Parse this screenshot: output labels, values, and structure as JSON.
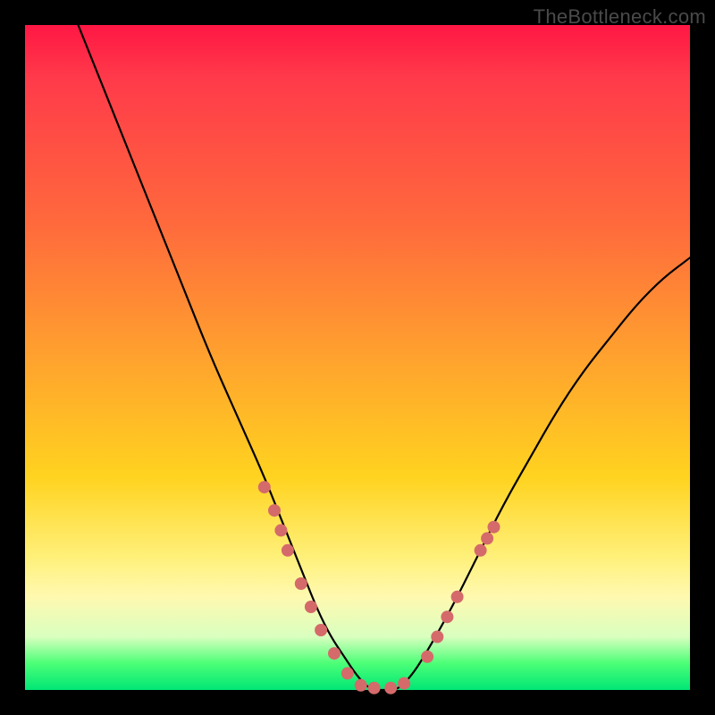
{
  "watermark": "TheBottleneck.com",
  "chart_data": {
    "type": "line",
    "title": "",
    "xlabel": "",
    "ylabel": "",
    "xlim": [
      0,
      100
    ],
    "ylim": [
      0,
      100
    ],
    "series": [
      {
        "name": "bottleneck-curve",
        "x": [
          8,
          12,
          16,
          20,
          24,
          28,
          32,
          36,
          38,
          40,
          42,
          44,
          46,
          48,
          50,
          52,
          54,
          56,
          58,
          60,
          64,
          68,
          72,
          76,
          80,
          84,
          88,
          92,
          96,
          100
        ],
        "y": [
          100,
          90,
          80,
          70,
          60,
          50,
          41,
          32,
          27,
          22,
          17,
          12,
          8,
          5,
          2,
          0,
          0,
          0,
          2,
          5,
          12,
          20,
          28,
          35,
          42,
          48,
          53,
          58,
          62,
          65
        ]
      }
    ],
    "markers": {
      "name": "salmon-dots",
      "color": "#d46a6a",
      "points": [
        {
          "x": 36.0,
          "y": 30.5
        },
        {
          "x": 37.5,
          "y": 27.0
        },
        {
          "x": 38.5,
          "y": 24.0
        },
        {
          "x": 39.5,
          "y": 21.0
        },
        {
          "x": 41.5,
          "y": 16.0
        },
        {
          "x": 43.0,
          "y": 12.5
        },
        {
          "x": 44.5,
          "y": 9.0
        },
        {
          "x": 46.5,
          "y": 5.5
        },
        {
          "x": 48.5,
          "y": 2.5
        },
        {
          "x": 50.5,
          "y": 0.7
        },
        {
          "x": 52.5,
          "y": 0.3
        },
        {
          "x": 55.0,
          "y": 0.3
        },
        {
          "x": 57.0,
          "y": 1.0
        },
        {
          "x": 60.5,
          "y": 5.0
        },
        {
          "x": 62.0,
          "y": 8.0
        },
        {
          "x": 63.5,
          "y": 11.0
        },
        {
          "x": 65.0,
          "y": 14.0
        },
        {
          "x": 68.5,
          "y": 21.0
        },
        {
          "x": 69.5,
          "y": 22.8
        },
        {
          "x": 70.5,
          "y": 24.5
        }
      ]
    }
  }
}
